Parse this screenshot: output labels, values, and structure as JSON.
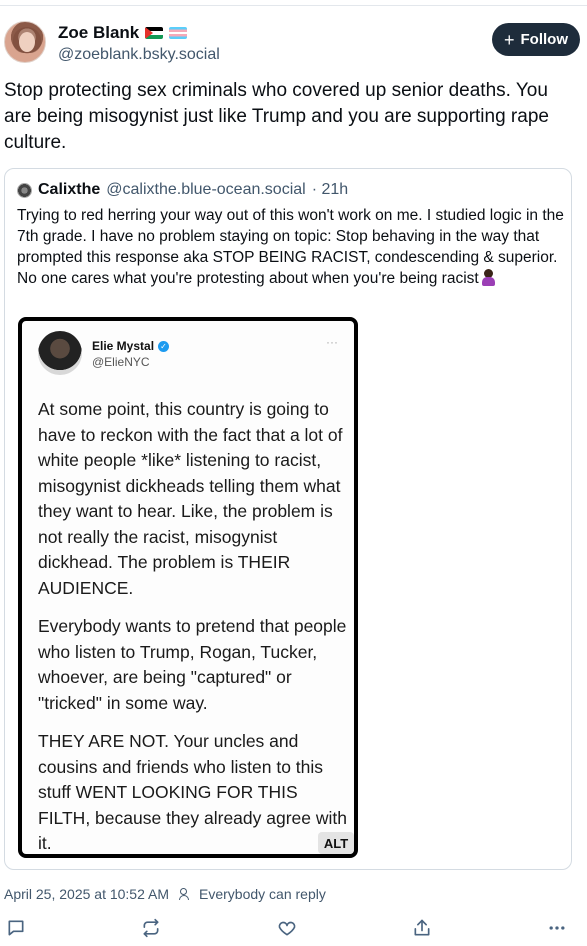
{
  "author": {
    "display_name": "Zoe Blank",
    "handle": "@zoeblank.bsky.social",
    "flags": [
      "palestine-flag",
      "transgender-flag"
    ]
  },
  "follow_button": {
    "label": "Follow",
    "icon": "plus-icon"
  },
  "post": {
    "text": "Stop protecting sex criminals who covered up senior deaths. You are being misogynist just like Trump and you are supporting rape culture."
  },
  "quote": {
    "display_name": "Calixthe",
    "handle": "@calixthe.blue-ocean.social",
    "time": "· 21h",
    "text": "Trying to red herring your way out of this won't work on me. I studied logic in the 7th grade. I have no problem staying on topic: Stop behaving in the way that prompted this response aka STOP BEING RACIST, condescending & superior. No one cares what you're protesting about when you're being racist",
    "emoji": "woman-shrugging-emoji",
    "image": {
      "tweet_name": "Elie Mystal",
      "tweet_handle": "@ElieNYC",
      "paragraphs": [
        "At some point, this country is going to have to reckon with the fact that a lot of white people *like* listening to racist, misogynist dickheads telling them what they want to hear. Like, the problem is not really the racist, misogynist dickhead. The problem is THEIR AUDIENCE.",
        "Everybody wants to pretend that people who listen to Trump, Rogan, Tucker, whoever, are being \"captured\" or \"tricked\" in some way.",
        "THEY ARE NOT. Your uncles and cousins and friends who listen to this stuff WENT LOOKING FOR THIS FILTH, because they already agree with it."
      ],
      "alt_label": "ALT"
    }
  },
  "meta": {
    "timestamp": "April 25, 2025 at 10:52 AM",
    "reply_setting": "Everybody can reply"
  },
  "actions": [
    "reply-icon",
    "repost-icon",
    "like-icon",
    "share-icon",
    "more-icon"
  ],
  "colors": {
    "accent_button": "#1e2c3b",
    "muted_text": "#42576c",
    "border": "#d4dbe2"
  }
}
